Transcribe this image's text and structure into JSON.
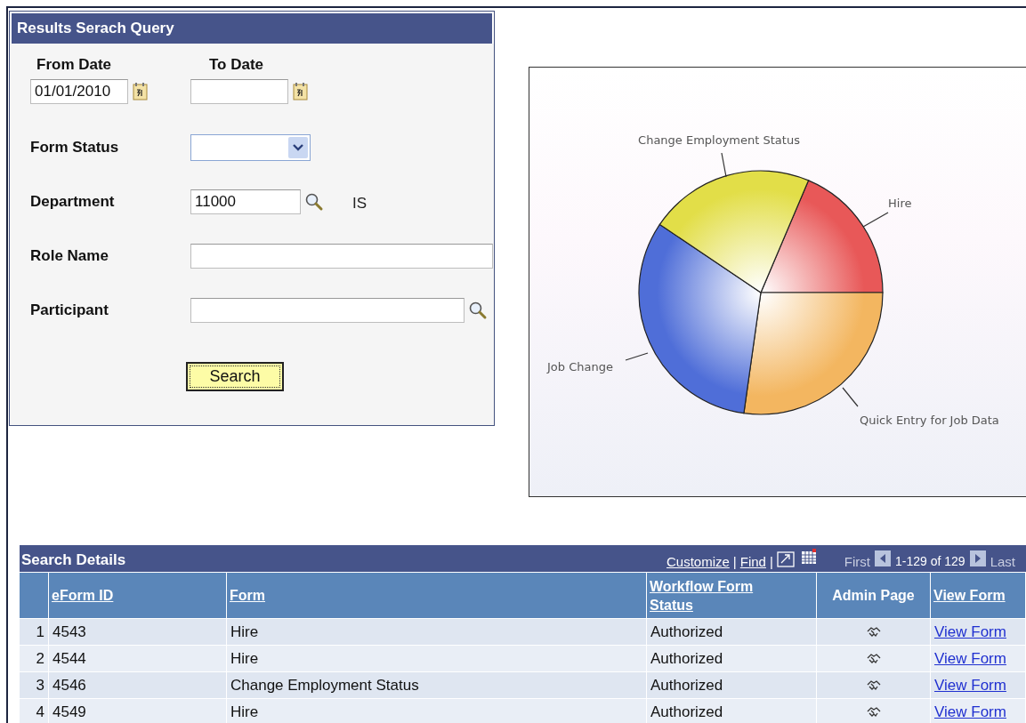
{
  "query_panel": {
    "title": "Results Serach Query",
    "from_date": {
      "label": "From Date",
      "value": "01/01/2010"
    },
    "to_date": {
      "label": "To Date"
    },
    "form_status": {
      "label": "Form Status"
    },
    "department": {
      "label": "Department",
      "value": "11000",
      "description": "IS"
    },
    "role_name": {
      "label": "Role Name"
    },
    "participant": {
      "label": "Participant"
    },
    "search_button": "Search"
  },
  "chart": {
    "slices": [
      {
        "label": "Hire",
        "color": "#e85858"
      },
      {
        "label": "Quick Entry for Job Data",
        "color": "#f3b660"
      },
      {
        "label": "Job Change",
        "color": "#4f6ed8"
      },
      {
        "label": "Change Employment Status",
        "color": "#e2de48"
      }
    ]
  },
  "search_details": {
    "title": "Search Details",
    "toolbar_links": [
      "Customize",
      "Find"
    ],
    "separator": "|",
    "nav": {
      "first": "First",
      "range": "1-129 of 129",
      "last": "Last"
    },
    "columns": [
      {
        "label": "eForm ID",
        "sortable": true
      },
      {
        "label": "Form",
        "sortable": true
      },
      {
        "label": "Workflow Form Status",
        "sortable": true
      },
      {
        "label": "Admin Page",
        "sortable": false
      },
      {
        "label": "View Form",
        "sortable": true
      }
    ],
    "rows": [
      {
        "number": "1",
        "eform_id": "4543",
        "form": "Hire",
        "status": "Authorized",
        "link": "View Form"
      },
      {
        "number": "2",
        "eform_id": "4544",
        "form": "Hire",
        "status": "Authorized",
        "link": "View Form"
      },
      {
        "number": "3",
        "eform_id": "4546",
        "form": "Change Employment Status",
        "status": "Authorized",
        "link": "View Form"
      },
      {
        "number": "4",
        "eform_id": "4549",
        "form": "Hire",
        "status": "Authorized",
        "link": "View Form"
      }
    ]
  }
}
